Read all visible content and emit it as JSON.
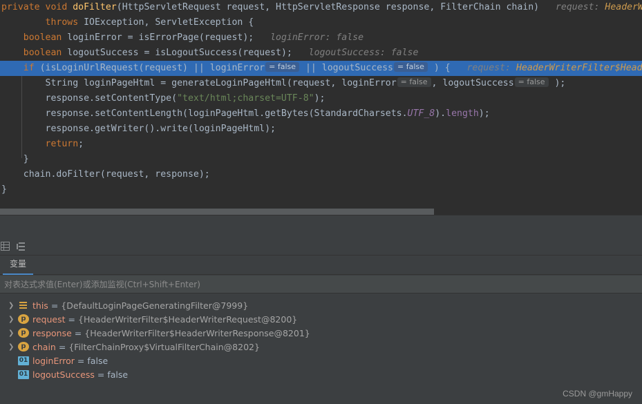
{
  "editor": {
    "lines": [
      {
        "id": "line-1",
        "highlighted": false,
        "tokens": [
          {
            "t": "kw",
            "v": "private "
          },
          {
            "t": "kw",
            "v": "void "
          },
          {
            "t": "meth",
            "v": "doFilter"
          },
          {
            "t": "plain",
            "v": "(HttpServletRequest request, HttpServletResponse response, FilterChain chain)  "
          },
          {
            "t": "hint",
            "v": " request: "
          },
          {
            "t": "hintv",
            "v": "HeaderWr"
          }
        ]
      },
      {
        "id": "line-2",
        "highlighted": false,
        "tokens": [
          {
            "t": "plain",
            "v": "        "
          },
          {
            "t": "kw",
            "v": "throws "
          },
          {
            "t": "plain",
            "v": "IOException, ServletException {"
          }
        ]
      },
      {
        "id": "line-3",
        "highlighted": false,
        "tokens": [
          {
            "t": "plain",
            "v": "    "
          },
          {
            "t": "kw",
            "v": "boolean "
          },
          {
            "t": "plain",
            "v": "loginError = isErrorPage(request);   "
          },
          {
            "t": "hint",
            "v": "loginError: false"
          }
        ]
      },
      {
        "id": "line-4",
        "highlighted": false,
        "tokens": [
          {
            "t": "plain",
            "v": "    "
          },
          {
            "t": "kw",
            "v": "boolean "
          },
          {
            "t": "plain",
            "v": "logoutSuccess = isLogoutSuccess(request);   "
          },
          {
            "t": "hint",
            "v": "logoutSuccess: false"
          }
        ]
      },
      {
        "id": "line-5",
        "highlighted": true,
        "tokens": [
          {
            "t": "plain",
            "v": "    "
          },
          {
            "t": "kw",
            "v": "if "
          },
          {
            "t": "plain",
            "v": "(isLoginUrlRequest(request) || loginError"
          },
          {
            "t": "badge",
            "v": "= false"
          },
          {
            "t": "plain",
            "v": " || logoutSuccess"
          },
          {
            "t": "badge",
            "v": "= false"
          },
          {
            "t": "plain",
            "v": " ) {  "
          },
          {
            "t": "hint",
            "v": " request: "
          },
          {
            "t": "hintv",
            "v": "HeaderWriterFilter$Head"
          }
        ]
      },
      {
        "id": "line-6",
        "highlighted": false,
        "tokens": [
          {
            "t": "plain",
            "v": "        String loginPageHtml = generateLoginPageHtml(request, loginError"
          },
          {
            "t": "badge",
            "v": "= false"
          },
          {
            "t": "plain",
            "v": ", logoutSuccess"
          },
          {
            "t": "badge",
            "v": "= false"
          },
          {
            "t": "plain",
            "v": " );"
          }
        ]
      },
      {
        "id": "line-7",
        "highlighted": false,
        "tokens": [
          {
            "t": "plain",
            "v": "        response.setContentType("
          },
          {
            "t": "str",
            "v": "\"text/html;charset=UTF-8\""
          },
          {
            "t": "plain",
            "v": ");"
          }
        ]
      },
      {
        "id": "line-8",
        "highlighted": false,
        "tokens": [
          {
            "t": "plain",
            "v": "        response.setContentLength(loginPageHtml.getBytes(StandardCharsets."
          },
          {
            "t": "fld",
            "v": "UTF_8"
          },
          {
            "t": "plain",
            "v": ")."
          },
          {
            "t": "purple",
            "v": "length"
          },
          {
            "t": "plain",
            "v": ");"
          }
        ]
      },
      {
        "id": "line-9",
        "highlighted": false,
        "tokens": [
          {
            "t": "plain",
            "v": "        response.getWriter().write(loginPageHtml);"
          }
        ]
      },
      {
        "id": "line-10",
        "highlighted": false,
        "tokens": [
          {
            "t": "plain",
            "v": "        "
          },
          {
            "t": "kw",
            "v": "return"
          },
          {
            "t": "plain",
            "v": ";"
          }
        ]
      },
      {
        "id": "line-11",
        "highlighted": false,
        "tokens": [
          {
            "t": "plain",
            "v": "    }"
          }
        ]
      },
      {
        "id": "line-12",
        "highlighted": false,
        "tokens": [
          {
            "t": "plain",
            "v": "    chain.doFilter(request, response);"
          }
        ]
      },
      {
        "id": "line-13",
        "highlighted": false,
        "tokens": [
          {
            "t": "plain",
            "v": "}"
          }
        ]
      }
    ]
  },
  "debug": {
    "toolbar": {
      "icons": [
        {
          "name": "table-view-icon"
        },
        {
          "name": "sort-list-icon"
        }
      ]
    },
    "tabs": [
      {
        "id": "tab-variables",
        "label": "变量",
        "active": true
      }
    ],
    "eval_hint": "对表达式求值(Enter)或添加监视(Ctrl+Shift+Enter)",
    "variables": [
      {
        "id": "var-this",
        "expandable": true,
        "arrow": "❯",
        "icon": "this-icon",
        "icon_kind": "this",
        "icon_text": "",
        "name": "this",
        "eq": "=",
        "value": "{DefaultLoginPageGeneratingFilter@7999}",
        "value_kind": "object"
      },
      {
        "id": "var-request",
        "expandable": true,
        "arrow": "❯",
        "icon": "parameter-icon",
        "icon_kind": "param",
        "icon_text": "p",
        "name": "request",
        "eq": "=",
        "value": "{HeaderWriterFilter$HeaderWriterRequest@8200}",
        "value_kind": "object"
      },
      {
        "id": "var-response",
        "expandable": true,
        "arrow": "❯",
        "icon": "parameter-icon",
        "icon_kind": "param",
        "icon_text": "p",
        "name": "response",
        "eq": "=",
        "value": "{HeaderWriterFilter$HeaderWriterResponse@8201}",
        "value_kind": "object"
      },
      {
        "id": "var-chain",
        "expandable": true,
        "arrow": "❯",
        "icon": "parameter-icon",
        "icon_kind": "param",
        "icon_text": "p",
        "name": "chain",
        "eq": "=",
        "value": "{FilterChainProxy$VirtualFilterChain@8202}",
        "value_kind": "object"
      },
      {
        "id": "var-loginError",
        "expandable": false,
        "arrow": "",
        "icon": "primitive-icon",
        "icon_kind": "prim",
        "icon_text": "01",
        "name": "loginError",
        "eq": "=",
        "value": "false",
        "value_kind": "bool"
      },
      {
        "id": "var-logoutSuccess",
        "expandable": false,
        "arrow": "",
        "icon": "primitive-icon",
        "icon_kind": "prim",
        "icon_text": "01",
        "name": "logoutSuccess",
        "eq": "=",
        "value": "false",
        "value_kind": "bool"
      }
    ]
  },
  "watermark": "CSDN @gmHappy",
  "colors": {
    "editor_bg": "#2e2e2e",
    "panel_bg": "#3c3f41",
    "highlight": "#2f6ab4",
    "keyword": "#cc7832",
    "method": "#ffc66d",
    "string": "#6a8759",
    "var_name": "#e8967a",
    "accent_tab": "#4a88c7"
  }
}
